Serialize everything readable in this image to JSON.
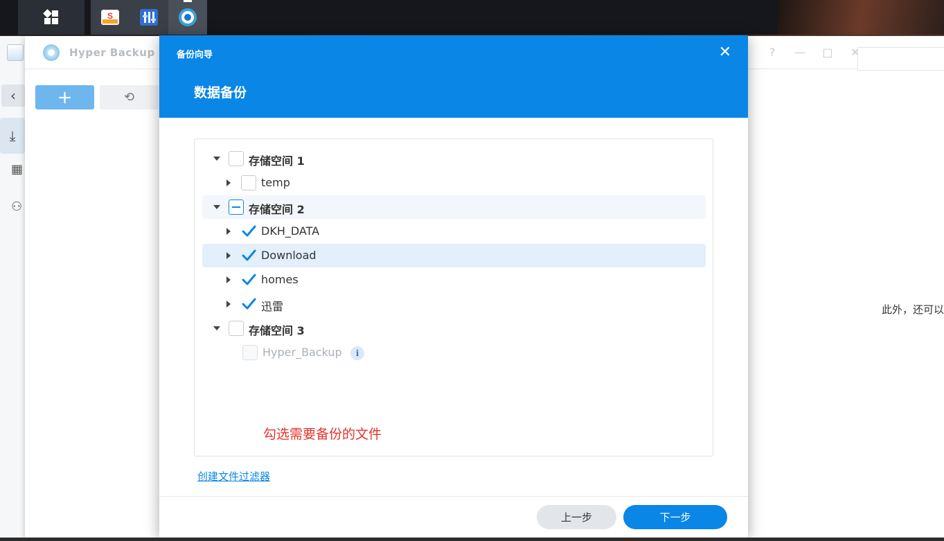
{
  "taskbar": {
    "apps": [
      {
        "icon": "storage-app-icon"
      },
      {
        "icon": "control-panel-icon"
      },
      {
        "icon": "hyper-backup-icon",
        "active": true
      }
    ]
  },
  "window": {
    "title": "Hyper Backup",
    "controls": [
      "?",
      "—",
      "□",
      "✕"
    ],
    "toolbar": {
      "add_label": "+",
      "history_icon": "history-icon"
    },
    "background_text": "此外，还可以"
  },
  "dialog": {
    "wizard_title": "备份向导",
    "close_label": "✕",
    "step_title": "数据备份",
    "tree": [
      {
        "label": "存储空间 1",
        "level": 0,
        "expanded": true,
        "state": "unchecked",
        "bold": true
      },
      {
        "label": "temp",
        "level": 1,
        "expanded": false,
        "state": "unchecked"
      },
      {
        "label": "存储空间 2",
        "level": 0,
        "expanded": true,
        "state": "partial",
        "bold": true
      },
      {
        "label": "DKH_DATA",
        "level": 1,
        "expanded": false,
        "state": "checked"
      },
      {
        "label": "Download",
        "level": 1,
        "expanded": false,
        "state": "checked",
        "selected": true
      },
      {
        "label": "homes",
        "level": 1,
        "expanded": false,
        "state": "checked"
      },
      {
        "label": "迅雷",
        "level": 1,
        "expanded": false,
        "state": "checked"
      },
      {
        "label": "存储空间 3",
        "level": 0,
        "expanded": true,
        "state": "unchecked",
        "bold": true
      },
      {
        "label": "Hyper_Backup",
        "level": 1,
        "state": "disabled",
        "info": "i"
      }
    ],
    "annotation": "勾选需要备份的文件",
    "filter_link": "创建文件过滤器",
    "prev_button": "上一步",
    "next_button": "下一步"
  }
}
